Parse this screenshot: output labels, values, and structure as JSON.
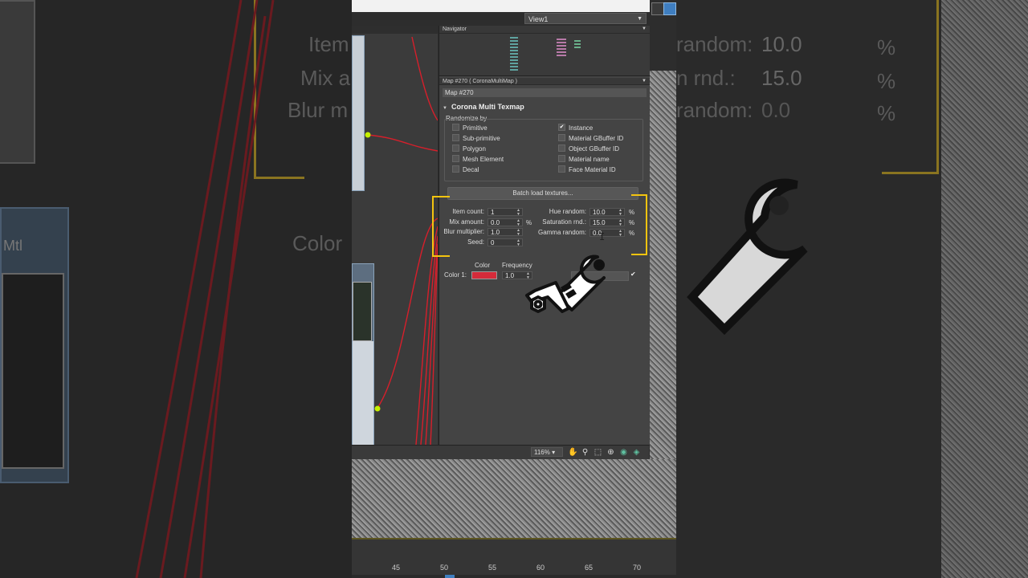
{
  "viewport_dropdown": "View1",
  "navigator": {
    "title": "Navigator"
  },
  "map_panel": {
    "title": "Map #270  ( CoronaMultiMap )",
    "map_name": "Map #270",
    "rollout_title": "Corona Multi Texmap",
    "randomize_by_label": "Randomize by",
    "left_options": [
      {
        "label": "Primitive",
        "checked": false
      },
      {
        "label": "Sub-primitive",
        "checked": false
      },
      {
        "label": "Polygon",
        "checked": false
      },
      {
        "label": "Mesh Element",
        "checked": false
      },
      {
        "label": "Decal",
        "checked": false
      }
    ],
    "right_options": [
      {
        "label": "Instance",
        "checked": true
      },
      {
        "label": "Material GBuffer ID",
        "checked": false
      },
      {
        "label": "Object GBuffer ID",
        "checked": false
      },
      {
        "label": "Material name",
        "checked": false
      },
      {
        "label": "Face Material ID",
        "checked": false
      }
    ],
    "batch_button": "Batch load textures...",
    "params_left": [
      {
        "label": "Item count:",
        "value": "1",
        "unit": ""
      },
      {
        "label": "Mix amount:",
        "value": "0.0",
        "unit": "%"
      },
      {
        "label": "Blur multiplier:",
        "value": "1.0",
        "unit": ""
      },
      {
        "label": "Seed:",
        "value": "0",
        "unit": ""
      }
    ],
    "params_right": [
      {
        "label": "Hue random:",
        "value": "10.0",
        "unit": "%"
      },
      {
        "label": "Saturation rnd.:",
        "value": "15.0",
        "unit": "%"
      },
      {
        "label": "Gamma random:",
        "value": "0.0",
        "unit": "%"
      }
    ],
    "color_header": "Color",
    "frequency_header": "Frequency",
    "color_row_label": "Color 1:",
    "color_value": "#d42b3a",
    "frequency_value": "1.0",
    "enabled_check": "✔"
  },
  "statusbar": {
    "zoom": "116%"
  },
  "timeline_ticks": [
    "45",
    "50",
    "55",
    "60",
    "65",
    "70"
  ],
  "blurred_left": {
    "texts": [
      "Item",
      "Mix a",
      "Blur m",
      "Color",
      "Mtl"
    ]
  },
  "blurred_right": {
    "texts": [
      "random:",
      "n rnd.:",
      "random:"
    ],
    "values": [
      "10.0",
      "15.0",
      "0.0"
    ],
    "units": [
      "%",
      "%",
      "%"
    ]
  },
  "colors": {
    "highlight_bracket": "#f4c40f",
    "wire": "#d61f2b",
    "node_dot": "#c6f000"
  }
}
